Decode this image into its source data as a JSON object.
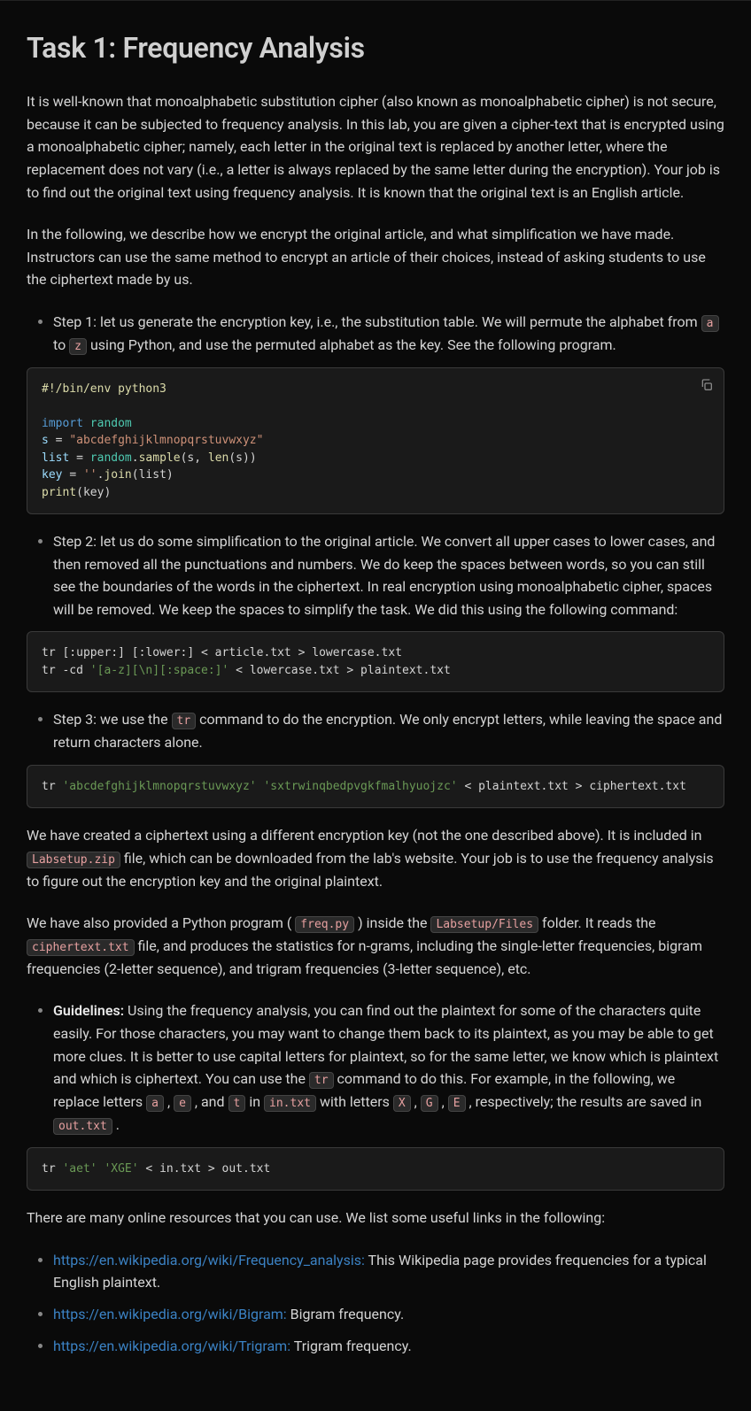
{
  "title": "Task 1: Frequency Analysis",
  "p1": "It is well-known that monoalphabetic substitution cipher (also known as monoalphabetic cipher) is not secure, because it can be subjected to frequency analysis. In this lab, you are given a cipher-text that is encrypted using a monoalphabetic cipher; namely, each letter in the original text is replaced by another letter, where the replacement does not vary (i.e., a letter is always replaced by the same letter during the encryption). Your job is to find out the original text using frequency analysis. It is known that the original text is an English article.",
  "p2": "In the following, we describe how we encrypt the original article, and what simplification we have made. Instructors can use the same method to encrypt an article of their choices, instead of asking students to use the ciphertext made by us.",
  "step1": {
    "prefix": "Step 1: let us generate the encryption key, i.e., the substitution table. We will permute the alphabet from ",
    "code_a": "a",
    "mid": " to ",
    "code_z": "z",
    "suffix": " using Python, and use the permuted alphabet as the key. See the following program."
  },
  "code1": {
    "shebang": "#!/bin/env python3",
    "l1_kw": "import",
    "l1_mod": " random",
    "l2_a": "s ",
    "l2_eq": "= ",
    "l2_str": "\"abcdefghijklmnopqrstuvwxyz\"",
    "l3_a": "list ",
    "l3_eq": "= ",
    "l3_b": "random",
    "l3_dot": ".",
    "l3_fn": "sample",
    "l3_args": "(s, ",
    "l3_len": "len",
    "l3_args2": "(s))",
    "l4_a": "key ",
    "l4_eq": "= ",
    "l4_str": "''",
    "l4_dot": ".",
    "l4_fn": "join",
    "l4_args": "(list)",
    "l5_fn": "print",
    "l5_args": "(key)"
  },
  "step2": "Step 2: let us do some simplification to the original article. We convert all upper cases to lower cases, and then removed all the punctuations and numbers. We do keep the spaces between words, so you can still see the boundaries of the words in the ciphertext. In real encryption using monoalphabetic cipher, spaces will be removed. We keep the spaces to simplify the task. We did this using the following command:",
  "code2": {
    "l1": "tr [:upper:] [:lower:] < article.txt > lowercase.txt",
    "l2_a": "tr -cd ",
    "l2_str": "'[a-z][\\n][:space:]'",
    "l2_b": " < lowercase.txt > plaintext.txt"
  },
  "step3": {
    "prefix": "Step 3: we use the ",
    "code": "tr",
    "suffix": " command to do the encryption. We only encrypt letters, while leaving the space and return characters alone."
  },
  "code3": {
    "a": "tr ",
    "s1": "'abcdefghijklmnopqrstuvwxyz'",
    "sp": " ",
    "s2": "'sxtrwinqbedpvgkfmalhyuojzc'",
    "b": " < plaintext.txt > ciphertext.txt"
  },
  "p3": {
    "a": "We have created a ciphertext using a different encryption key (not the one described above). It is included in ",
    "code1": "Labsetup.zip",
    "b": " file, which can be downloaded from the lab's website. Your job is to use the frequency analysis to figure out the encryption key and the original plaintext."
  },
  "p4": {
    "a": "We have also provided a Python program ( ",
    "code1": "freq.py",
    "b": " ) inside the ",
    "code2": "Labsetup/Files",
    "c": " folder. It reads the ",
    "code3": "ciphertext.txt",
    "d": " file, and produces the statistics for n-grams, including the single-letter frequencies, bigram frequencies (2-letter sequence), and trigram frequencies (3-letter sequence), etc."
  },
  "guidelines": {
    "label": "Guidelines:",
    "a": " Using the frequency analysis, you can find out the plaintext for some of the characters quite easily. For those characters, you may want to change them back to its plaintext, as you may be able to get more clues. It is better to use capital letters for plaintext, so for the same letter, we know which is plaintext and which is ciphertext. You can use the ",
    "tr": "tr",
    "b": " command to do this. For example, in the following, we replace letters ",
    "ca": "a",
    "comma1": " , ",
    "ce": "e",
    "comma2": " , and ",
    "ct": "t",
    "c": " in ",
    "in": "in.txt",
    "d": " with letters ",
    "cX": "X",
    "comma3": " , ",
    "cG": "G",
    "comma4": " , ",
    "cE": "E",
    "e": " , respectively; the results are saved in ",
    "out": "out.txt",
    "f": " ."
  },
  "code4": {
    "a": "tr ",
    "s1": "'aet'",
    "sp": " ",
    "s2": "'XGE'",
    "b": " < in.txt > out.txt"
  },
  "p5": "There are many online resources that you can use. We list some useful links in the following:",
  "links": {
    "l1": {
      "url": "https://en.wikipedia.org/wiki/Frequency_analysis:",
      "text": " This Wikipedia page provides frequencies for a typical English plaintext."
    },
    "l2": {
      "url": "https://en.wikipedia.org/wiki/Bigram:",
      "text": " Bigram frequency."
    },
    "l3": {
      "url": "https://en.wikipedia.org/wiki/Trigram:",
      "text": " Trigram frequency."
    }
  }
}
